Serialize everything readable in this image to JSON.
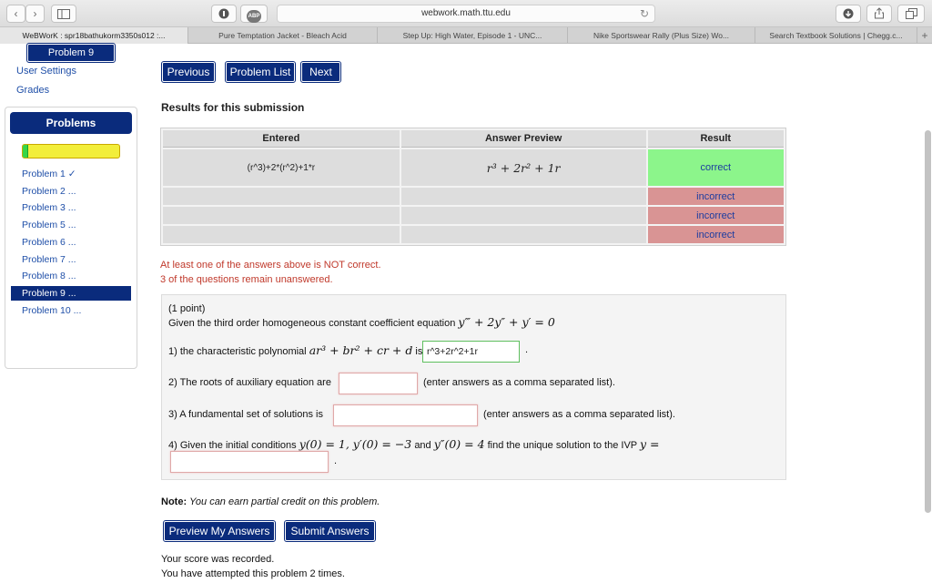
{
  "browser": {
    "url": "webwork.math.ttu.edu",
    "tabs": [
      {
        "label": "WeBWorK : spr18bathukorm3350s012 :...",
        "active": true
      },
      {
        "label": "Pure Temptation Jacket - Bleach Acid",
        "active": false
      },
      {
        "label": "Step Up: High Water, Episode 1 - UNC...",
        "active": false
      },
      {
        "label": "Nike Sportswear Rally (Plus Size) Wo...",
        "active": false
      },
      {
        "label": "Search Textbook Solutions | Chegg.c...",
        "active": false
      }
    ],
    "new_tab": "+",
    "back": "‹",
    "forward": "›",
    "reload": "↻",
    "ad_block": "ABP"
  },
  "sidebar": {
    "current_problem": "Problem 9",
    "links": [
      "User Settings",
      "Grades"
    ],
    "problems_header": "Problems",
    "progress_fraction": 0.06,
    "items": [
      {
        "label": "Problem 1 ✓",
        "active": false
      },
      {
        "label": "Problem 2 ...",
        "active": false
      },
      {
        "label": "Problem 3 ...",
        "active": false
      },
      {
        "label": "Problem 5 ...",
        "active": false
      },
      {
        "label": "Problem 6 ...",
        "active": false
      },
      {
        "label": "Problem 7 ...",
        "active": false
      },
      {
        "label": "Problem 8 ...",
        "active": false
      },
      {
        "label": "Problem 9 ...",
        "active": true
      },
      {
        "label": "Problem 10 ...",
        "active": false
      }
    ]
  },
  "nav": {
    "previous": "Previous",
    "problem_list": "Problem List",
    "next": "Next"
  },
  "results": {
    "heading": "Results for this submission",
    "columns": [
      "Entered",
      "Answer Preview",
      "Result"
    ],
    "rows": [
      {
        "entered": "(r^3)+2*(r^2)+1*r",
        "preview": "r³ + 2r² + 1r",
        "result": "correct"
      },
      {
        "entered": "",
        "preview": "",
        "result": "incorrect"
      },
      {
        "entered": "",
        "preview": "",
        "result": "incorrect"
      },
      {
        "entered": "",
        "preview": "",
        "result": "incorrect"
      }
    ],
    "warning_1": "At least one of the answers above is NOT correct.",
    "warning_2": "3 of the questions remain unanswered."
  },
  "problem": {
    "points": "(1 point)",
    "intro": "Given the third order homogeneous constant coefficient equation",
    "equation": "y‴ + 2y″ + y′ = 0",
    "q1_prefix": "1) the characteristic polynomial",
    "q1_poly": "ar³ + br² + cr + d",
    "q1_is": "is",
    "q1_value": "r^3+2r^2+1r",
    "q1_suffix": ".",
    "q2_text": "2) The roots of auxiliary equation are",
    "q2_value": "",
    "q2_hint": "(enter answers as a comma separated list).",
    "q3_text": "3) A fundamental set of solutions is",
    "q3_value": "",
    "q3_hint": "(enter answers as a comma separated list).",
    "q4_prefix": "4) Given the initial conditions",
    "q4_cond1": "y(0) = 1, y′(0) = −3",
    "q4_and": "and",
    "q4_cond2": "y″(0) = 4",
    "q4_suffix": "find the unique solution to the IVP",
    "q4_y": "y =",
    "q4_value": "",
    "q4_end": "."
  },
  "footer": {
    "note_label": "Note:",
    "note_text": "You can earn partial credit on this problem.",
    "preview_button": "Preview My Answers",
    "submit_button": "Submit Answers",
    "status_1": "Your score was recorded.",
    "status_2": "You have attempted this problem 2 times."
  }
}
